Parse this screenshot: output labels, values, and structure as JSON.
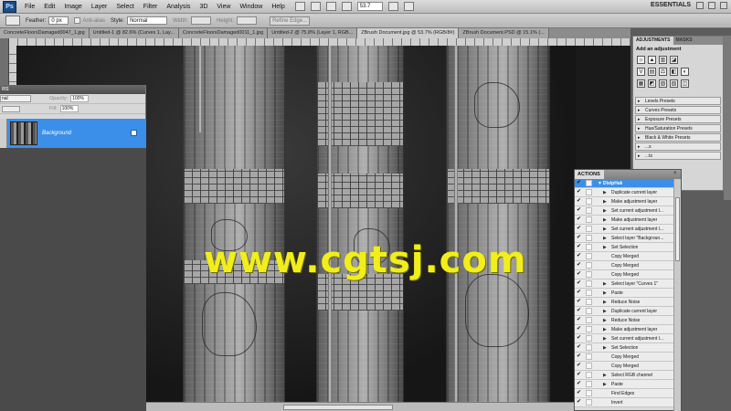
{
  "app": {
    "logo": "Ps",
    "workspace": "ESSENTIALS"
  },
  "menu": [
    "File",
    "Edit",
    "Image",
    "Layer",
    "Select",
    "Filter",
    "Analysis",
    "3D",
    "View",
    "Window",
    "Help"
  ],
  "zoom": "53.7",
  "options": {
    "feather_label": "Feather:",
    "feather_value": "0 px",
    "antialias_label": "Anti-alias",
    "style_label": "Style:",
    "style_value": "Normal",
    "width_label": "Width:",
    "height_label": "Height:",
    "refine_edge": "Refine Edge..."
  },
  "doc_tabs": [
    "ConcreteFloorsDamaged0047_1.jpg",
    "Untitled-1 @ 82.6% (Curves 1, Lay...",
    "ConcreteFloorsDamaged0011_1.jpg",
    "Untitled-2 @ 75.8% (Layer 1, RGB...",
    "ZBrush Document.jpg @ 53.7% (RGB/8#)",
    "ZBrush Document.PSD @ 15.1% (..."
  ],
  "watermark": "www.cgtsj.com",
  "layers": {
    "tab": "RS",
    "blend": "nal",
    "opacity_label": "Opacity:",
    "opacity_value": "100%",
    "fill_label": "Fill:",
    "fill_value": "100%",
    "layer_name": "Background"
  },
  "adjustments": {
    "tab_adjustments": "ADJUSTMENTS",
    "tab_masks": "MASKS",
    "title": "Add an adjustment",
    "icons_row1": [
      "☼",
      "▲",
      "▥",
      "◪",
      "▽"
    ],
    "icons_row2": [
      "V",
      "▤",
      "⚖",
      "◧",
      "◐"
    ],
    "icons_row3": [
      "▦",
      "◩",
      "▧",
      "▨",
      "◫"
    ],
    "presets": [
      "Levels Presets",
      "Curves Presets",
      "Exposure Presets",
      "Hue/Saturation Presets",
      "Black & White Presets",
      "...s",
      "...ts"
    ]
  },
  "actions": {
    "tab": "ACTIONS",
    "rows": [
      {
        "name": "DislpHak",
        "type": "set"
      },
      {
        "name": "Duplicate current layer"
      },
      {
        "name": "Make adjustment layer"
      },
      {
        "name": "Set current adjustment l..."
      },
      {
        "name": "Make adjustment layer"
      },
      {
        "name": "Set current adjustment l..."
      },
      {
        "name": "Select layer \"Backgroun..."
      },
      {
        "name": "Set Selection"
      },
      {
        "name": "Copy Merged",
        "noarrow": true
      },
      {
        "name": "Copy Merged",
        "noarrow": true
      },
      {
        "name": "Copy Merged",
        "noarrow": true
      },
      {
        "name": "Select layer \"Curves 1\""
      },
      {
        "name": "Paste"
      },
      {
        "name": "Reduce Noise"
      },
      {
        "name": "Duplicate current layer"
      },
      {
        "name": "Reduce Noise"
      },
      {
        "name": "Make adjustment layer"
      },
      {
        "name": "Set current adjustment l..."
      },
      {
        "name": "Set Selection"
      },
      {
        "name": "Copy Merged",
        "noarrow": true
      },
      {
        "name": "Copy Merged",
        "noarrow": true
      },
      {
        "name": "Select RGB channel"
      },
      {
        "name": "Paste"
      },
      {
        "name": "Find Edges",
        "noarrow": true
      },
      {
        "name": "Invert",
        "noarrow": true
      }
    ]
  }
}
